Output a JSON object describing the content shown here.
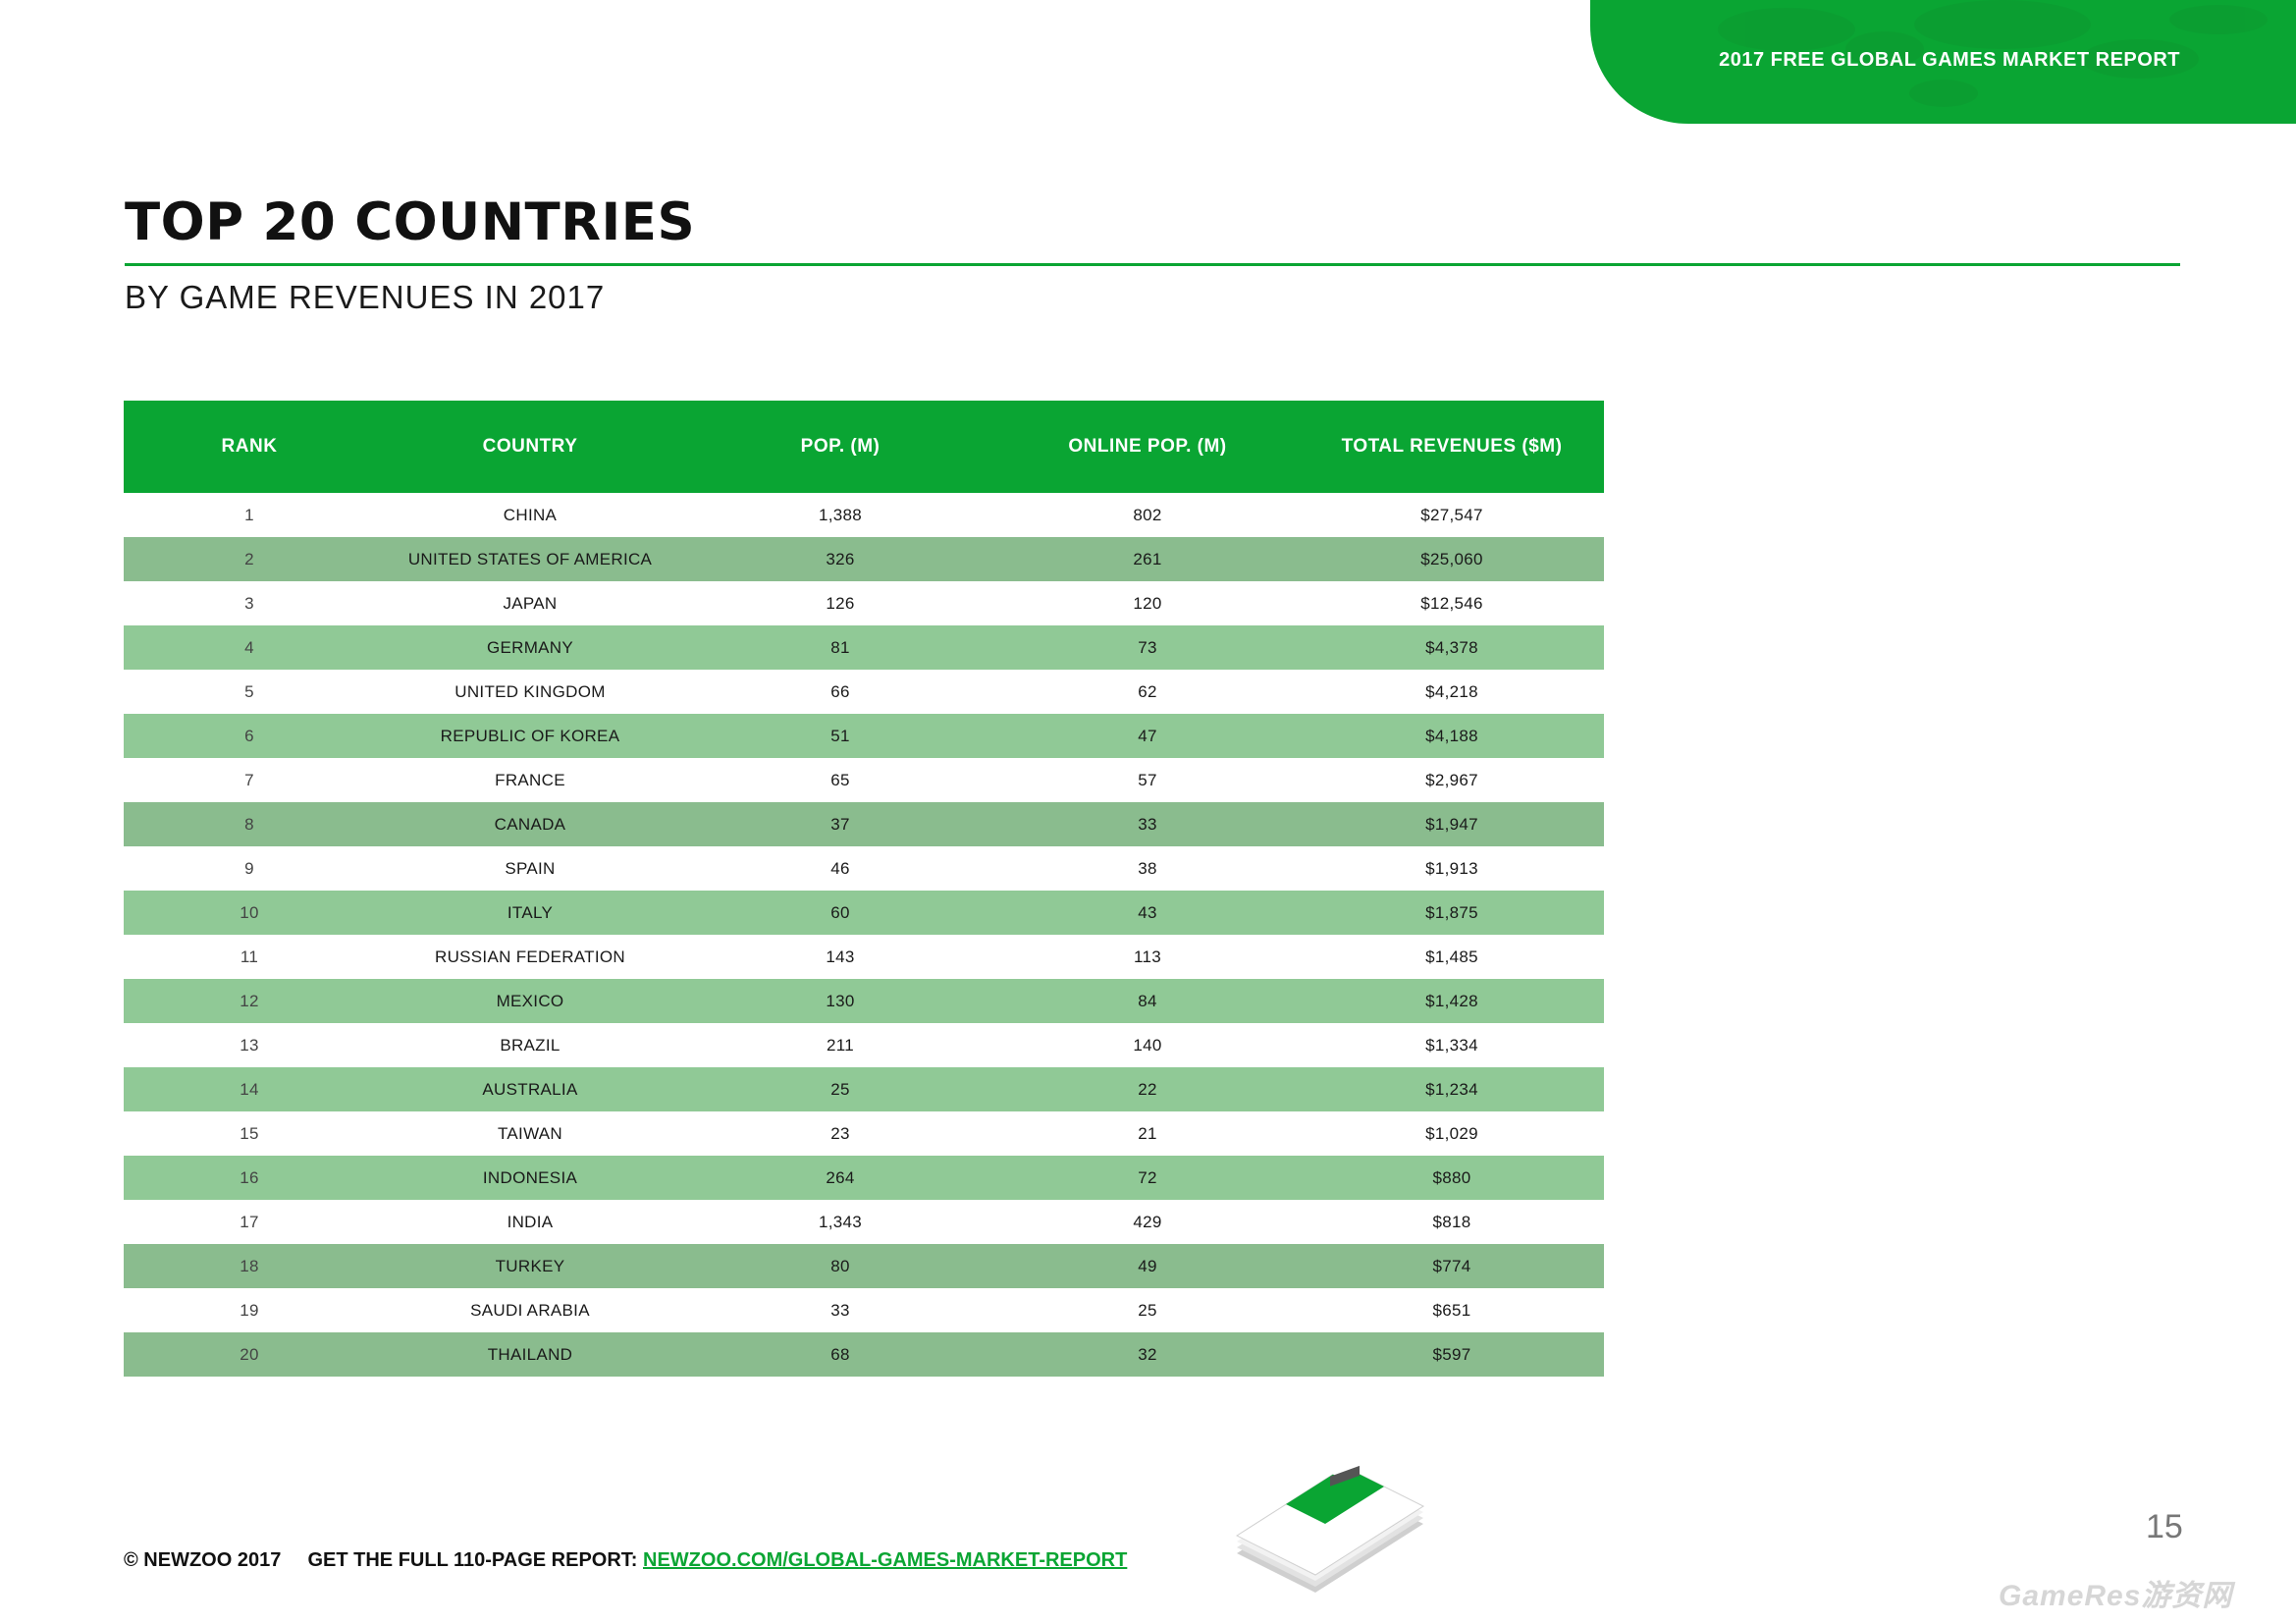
{
  "header": {
    "report_label": "2017 FREE GLOBAL GAMES MARKET REPORT"
  },
  "title": "TOP 20 COUNTRIES",
  "subtitle": "BY GAME REVENUES IN 2017",
  "table": {
    "columns": [
      "RANK",
      "COUNTRY",
      "POP. (M)",
      "ONLINE POP. (M)",
      "TOTAL REVENUES ($M)"
    ],
    "rows": [
      [
        "1",
        "CHINA",
        "1,388",
        "802",
        "$27,547"
      ],
      [
        "2",
        "UNITED STATES OF AMERICA",
        "326",
        "261",
        "$25,060"
      ],
      [
        "3",
        "JAPAN",
        "126",
        "120",
        "$12,546"
      ],
      [
        "4",
        "GERMANY",
        "81",
        "73",
        "$4,378"
      ],
      [
        "5",
        "UNITED KINGDOM",
        "66",
        "62",
        "$4,218"
      ],
      [
        "6",
        "REPUBLIC OF KOREA",
        "51",
        "47",
        "$4,188"
      ],
      [
        "7",
        "FRANCE",
        "65",
        "57",
        "$2,967"
      ],
      [
        "8",
        "CANADA",
        "37",
        "33",
        "$1,947"
      ],
      [
        "9",
        "SPAIN",
        "46",
        "38",
        "$1,913"
      ],
      [
        "10",
        "ITALY",
        "60",
        "43",
        "$1,875"
      ],
      [
        "11",
        "RUSSIAN FEDERATION",
        "143",
        "113",
        "$1,485"
      ],
      [
        "12",
        "MEXICO",
        "130",
        "84",
        "$1,428"
      ],
      [
        "13",
        "BRAZIL",
        "211",
        "140",
        "$1,334"
      ],
      [
        "14",
        "AUSTRALIA",
        "25",
        "22",
        "$1,234"
      ],
      [
        "15",
        "TAIWAN",
        "23",
        "21",
        "$1,029"
      ],
      [
        "16",
        "INDONESIA",
        "264",
        "72",
        "$880"
      ],
      [
        "17",
        "INDIA",
        "1,343",
        "429",
        "$818"
      ],
      [
        "18",
        "TURKEY",
        "80",
        "49",
        "$774"
      ],
      [
        "19",
        "SAUDI ARABIA",
        "33",
        "25",
        "$651"
      ],
      [
        "20",
        "THAILAND",
        "68",
        "32",
        "$597"
      ]
    ]
  },
  "footer": {
    "copyright": "© NEWZOO 2017",
    "cta": "GET THE FULL 110-PAGE REPORT:",
    "link": "NEWZOO.COM/GLOBAL-GAMES-MARKET-REPORT"
  },
  "page_number": "15",
  "watermark": "GameRes游资网",
  "colors": {
    "brand_green": "#0aa533",
    "row_alt": "#90c996"
  },
  "icons": {
    "cover": "report-cover-icon",
    "map": "world-map-icon"
  }
}
